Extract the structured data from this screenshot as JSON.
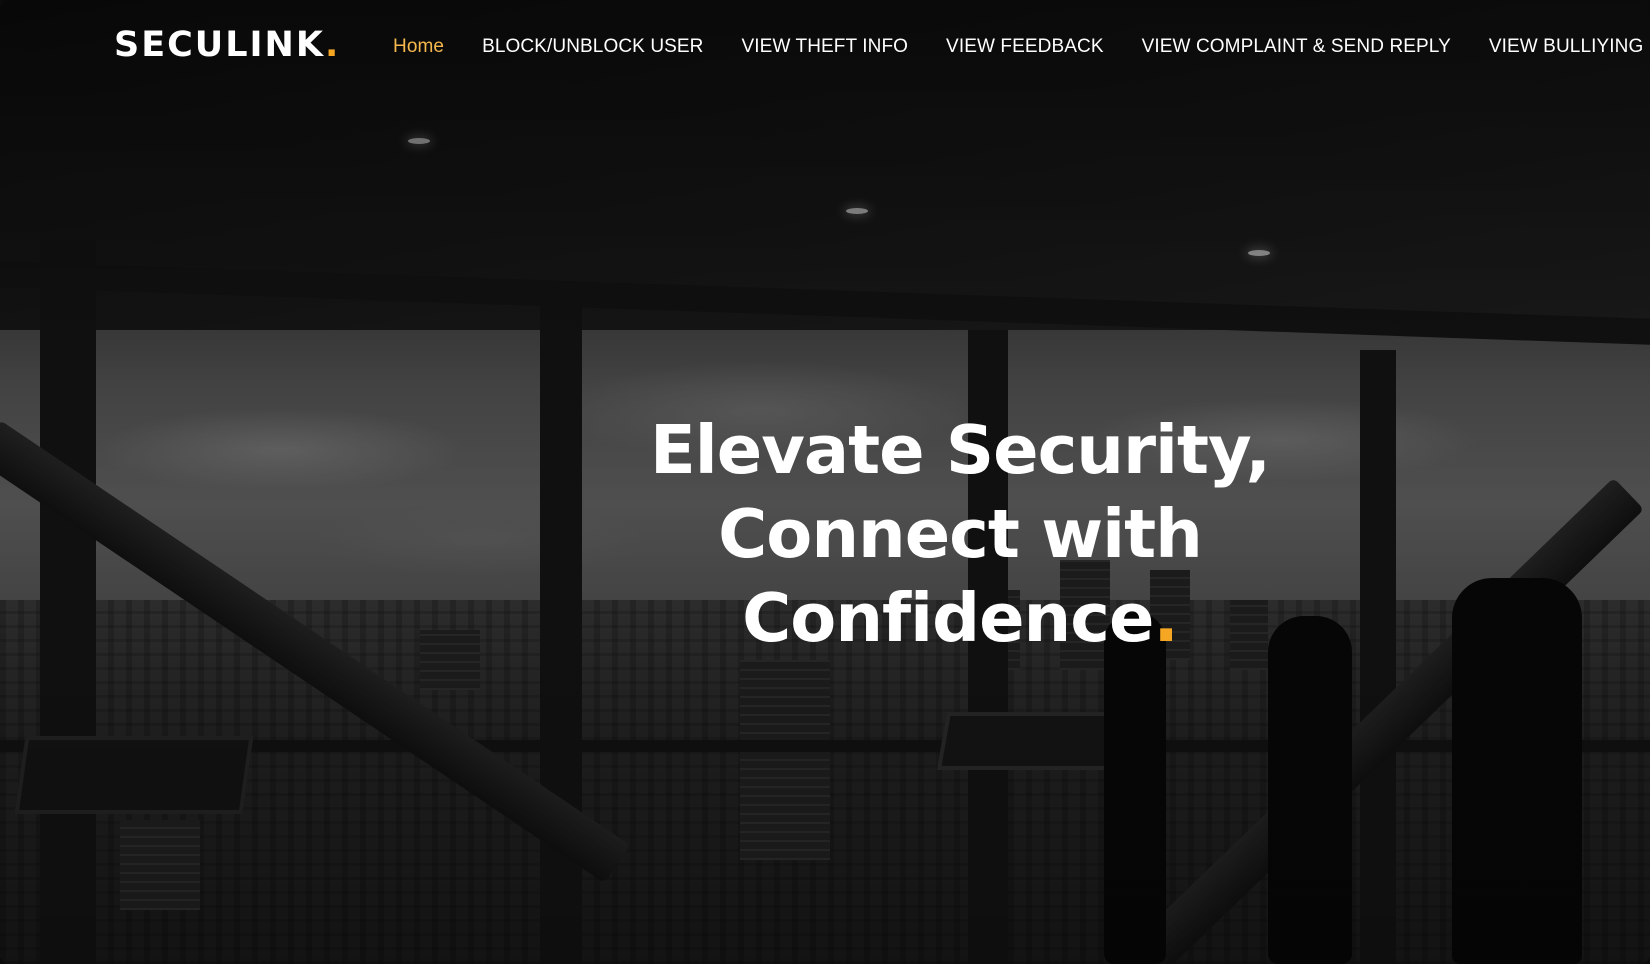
{
  "brand": {
    "name": "SECULINK",
    "dot": ".",
    "accent_color": "#f5a623"
  },
  "nav": {
    "items": [
      {
        "label": "Home",
        "active": true
      },
      {
        "label": "BLOCK/UNBLOCK USER",
        "active": false
      },
      {
        "label": "VIEW THEFT INFO",
        "active": false
      },
      {
        "label": "VIEW FEEDBACK",
        "active": false
      },
      {
        "label": "VIEW COMPLAINT & SEND REPLY",
        "active": false
      },
      {
        "label": "VIEW BULLIYING II",
        "active": false
      }
    ]
  },
  "hero": {
    "line1": "Elevate Security,",
    "line2": "Connect with",
    "line3": "Confidence",
    "dot": ".",
    "background": "grayscale-office-cityscape-photo"
  }
}
